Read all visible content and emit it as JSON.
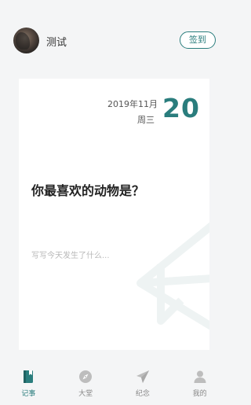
{
  "header": {
    "username": "测试",
    "signin_label": "签到"
  },
  "card": {
    "year_month": "2019年11月",
    "weekday": "周三",
    "day": "20",
    "question": "你最喜欢的动物是？",
    "write_placeholder": "写写今天发生了什么..."
  },
  "nav": {
    "items": [
      {
        "label": "记事",
        "icon": "notebook-icon",
        "active": true
      },
      {
        "label": "大堂",
        "icon": "compass-icon",
        "active": false
      },
      {
        "label": "纪念",
        "icon": "paper-plane-icon",
        "active": false
      },
      {
        "label": "我的",
        "icon": "person-icon",
        "active": false
      }
    ]
  },
  "colors": {
    "accent": "#2a7d7d",
    "background": "#f4f5f6",
    "card": "#ffffff",
    "inactive_icon": "#bdbdbd"
  }
}
